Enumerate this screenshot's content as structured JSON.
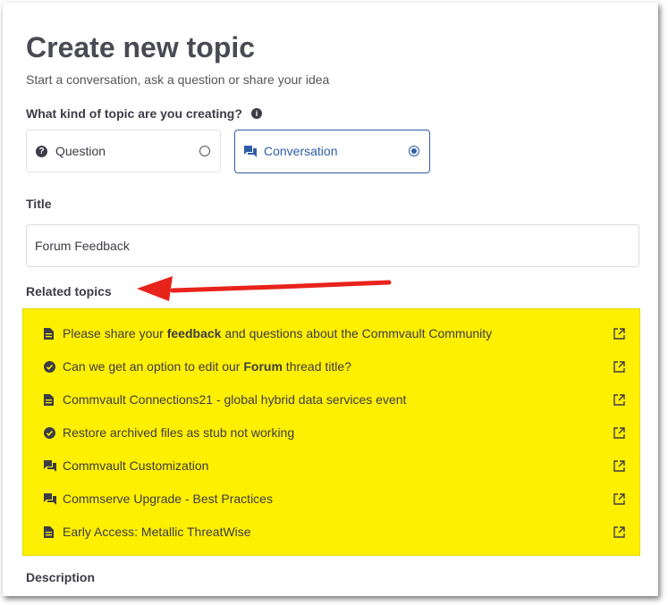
{
  "page": {
    "title": "Create new topic",
    "subtitle": "Start a conversation, ask a question or share your idea"
  },
  "topic_kind": {
    "label": "What kind of topic are you creating?",
    "info_icon": "info-icon",
    "options": [
      {
        "label": "Question",
        "icon": "question-icon",
        "selected": false
      },
      {
        "label": "Conversation",
        "icon": "conversation-icon",
        "selected": true
      }
    ]
  },
  "title_field": {
    "label": "Title",
    "value": "Forum Feedback"
  },
  "related": {
    "label": "Related topics",
    "highlight_color": "#ffef00",
    "items": [
      {
        "icon": "document-icon",
        "pre": "Please share your ",
        "bold": "feedback",
        "post": " and questions about the Commvault Community"
      },
      {
        "icon": "check-circle-icon",
        "pre": "Can we get an option to edit our ",
        "bold": "Forum",
        "post": " thread title?"
      },
      {
        "icon": "document-icon",
        "pre": "Commvault Connections21 - global hybrid data services event",
        "bold": "",
        "post": ""
      },
      {
        "icon": "check-circle-icon",
        "pre": "Restore archived files as stub not working",
        "bold": "",
        "post": ""
      },
      {
        "icon": "conversation-icon",
        "pre": "Commvault Customization",
        "bold": "",
        "post": ""
      },
      {
        "icon": "conversation-icon",
        "pre": "Commserve Upgrade - Best Practices",
        "bold": "",
        "post": ""
      },
      {
        "icon": "document-icon",
        "pre": "Early Access: Metallic ThreatWise",
        "bold": "",
        "post": ""
      }
    ]
  },
  "description": {
    "label": "Description"
  },
  "annotation": {
    "arrow_color": "#e8231b"
  }
}
